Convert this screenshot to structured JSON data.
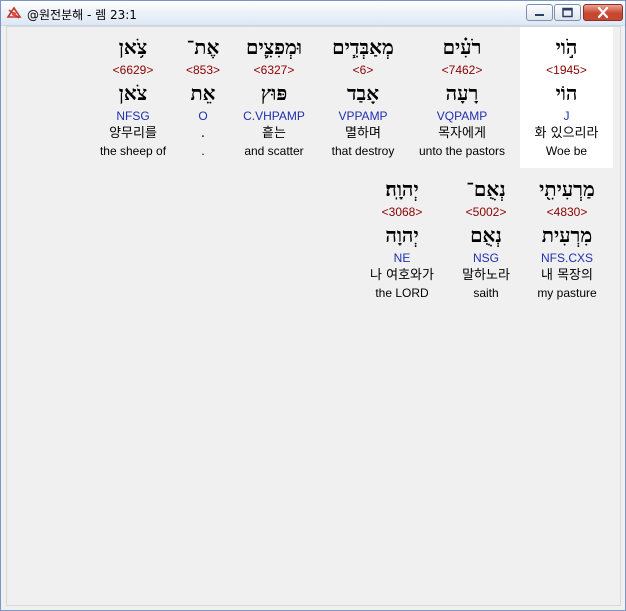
{
  "window": {
    "title": "@원전분해 - 렘 23:1"
  },
  "colors": {
    "strong": "#8b0000",
    "morph": "#1f2fb0",
    "highlight": "#ffffff"
  },
  "words": [
    {
      "heb": "הֹ֣וי",
      "strong": "<1945>",
      "lemma": "הוֹי",
      "morph": "J",
      "kor": "화 있으리라",
      "eng": "Woe be"
    },
    {
      "heb": "רֹעִ֗ים",
      "strong": "<7462>",
      "lemma": "רָעָה",
      "morph": "VQPAMP",
      "kor": "목자에게",
      "eng": "unto the pastors"
    },
    {
      "heb": "מְאַבְּדִ֧ים",
      "strong": "<6>",
      "lemma": "אָבַד",
      "morph": "VPPAMP",
      "kor": "멸하며",
      "eng": "that destroy"
    },
    {
      "heb": "וּמְפִצִ֛ים",
      "strong": "<6327>",
      "lemma": "פּוּץ",
      "morph": "C.VHPAMP",
      "kor": "흩는",
      "eng": "and scatter"
    },
    {
      "heb": "אֶת־",
      "strong": "<853>",
      "lemma": "אֵת",
      "morph": "O",
      "kor": ".",
      "eng": "."
    },
    {
      "heb": "צֹ֥אן",
      "strong": "<6629>",
      "lemma": "צֹאן",
      "morph": "NFSG",
      "kor": "양무리를",
      "eng": "the sheep of"
    },
    {
      "heb": "מַרְעִיתִ֖י",
      "strong": "<4830>",
      "lemma": "מִרְעִית",
      "morph": "NFS.CXS",
      "kor": "내 목장의",
      "eng": "my pasture"
    },
    {
      "heb": "נְאֻם־",
      "strong": "<5002>",
      "lemma": "נְאֻם",
      "morph": "NSG",
      "kor": "말하노라",
      "eng": "saith"
    },
    {
      "heb": "יְהוָֽה׃",
      "strong": "<3068>",
      "lemma": "יְהוָה",
      "morph": "NE",
      "kor": "나 여호와가",
      "eng": "the LORD"
    }
  ]
}
